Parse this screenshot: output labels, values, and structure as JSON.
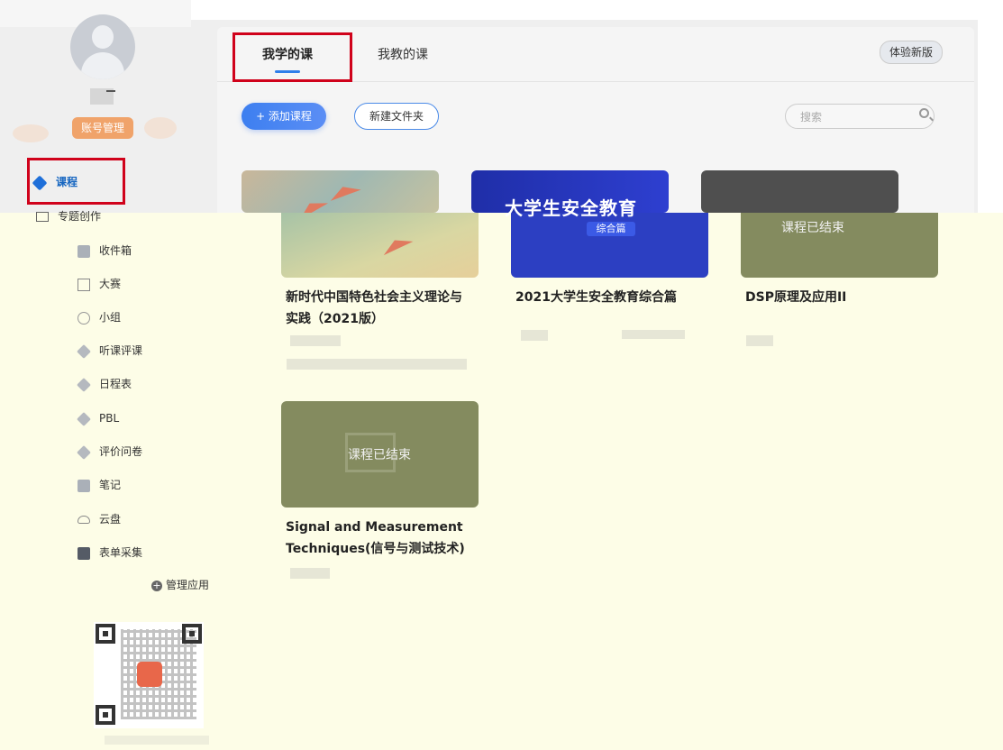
{
  "sidebar": {
    "account_button": "账号管理",
    "nav": {
      "course": "课程",
      "topic_creation": "专题创作",
      "inbox": "收件箱",
      "contest": "大赛",
      "group": "小组",
      "lesson_review": "听课评课",
      "schedule": "日程表",
      "pbl": "PBL",
      "survey": "评价问卷",
      "notes": "笔记",
      "cloud_disk": "云盘",
      "form_collect": "表单采集"
    },
    "manage_apps": "管理应用"
  },
  "header": {
    "tabs": [
      "我学的课",
      "我教的课"
    ],
    "active_tab": "我学的课",
    "try_new": "体验新版"
  },
  "toolbar": {
    "add_course": "+ 添加课程",
    "new_folder": "新建文件夹",
    "search_placeholder": "搜索"
  },
  "courses": [
    {
      "title_line1": "新时代中国特色社会主义理论与",
      "title_line2": "实践（2021版）"
    },
    {
      "title": "2021大学生安全教育综合篇",
      "cover_title": "大学生安全教育",
      "cover_badge": "综合篇"
    },
    {
      "title": "DSP原理及应用II",
      "status": "课程已结束"
    },
    {
      "title_line1": "Signal and Measurement",
      "title_line2": "Techniques(信号与测试技术)",
      "status": "课程已结束"
    }
  ],
  "colors": {
    "accent_blue": "#2f7fea",
    "account_orange": "#f0a36a",
    "highlight_red": "#d0021b",
    "ended_card": "#848b5f"
  }
}
